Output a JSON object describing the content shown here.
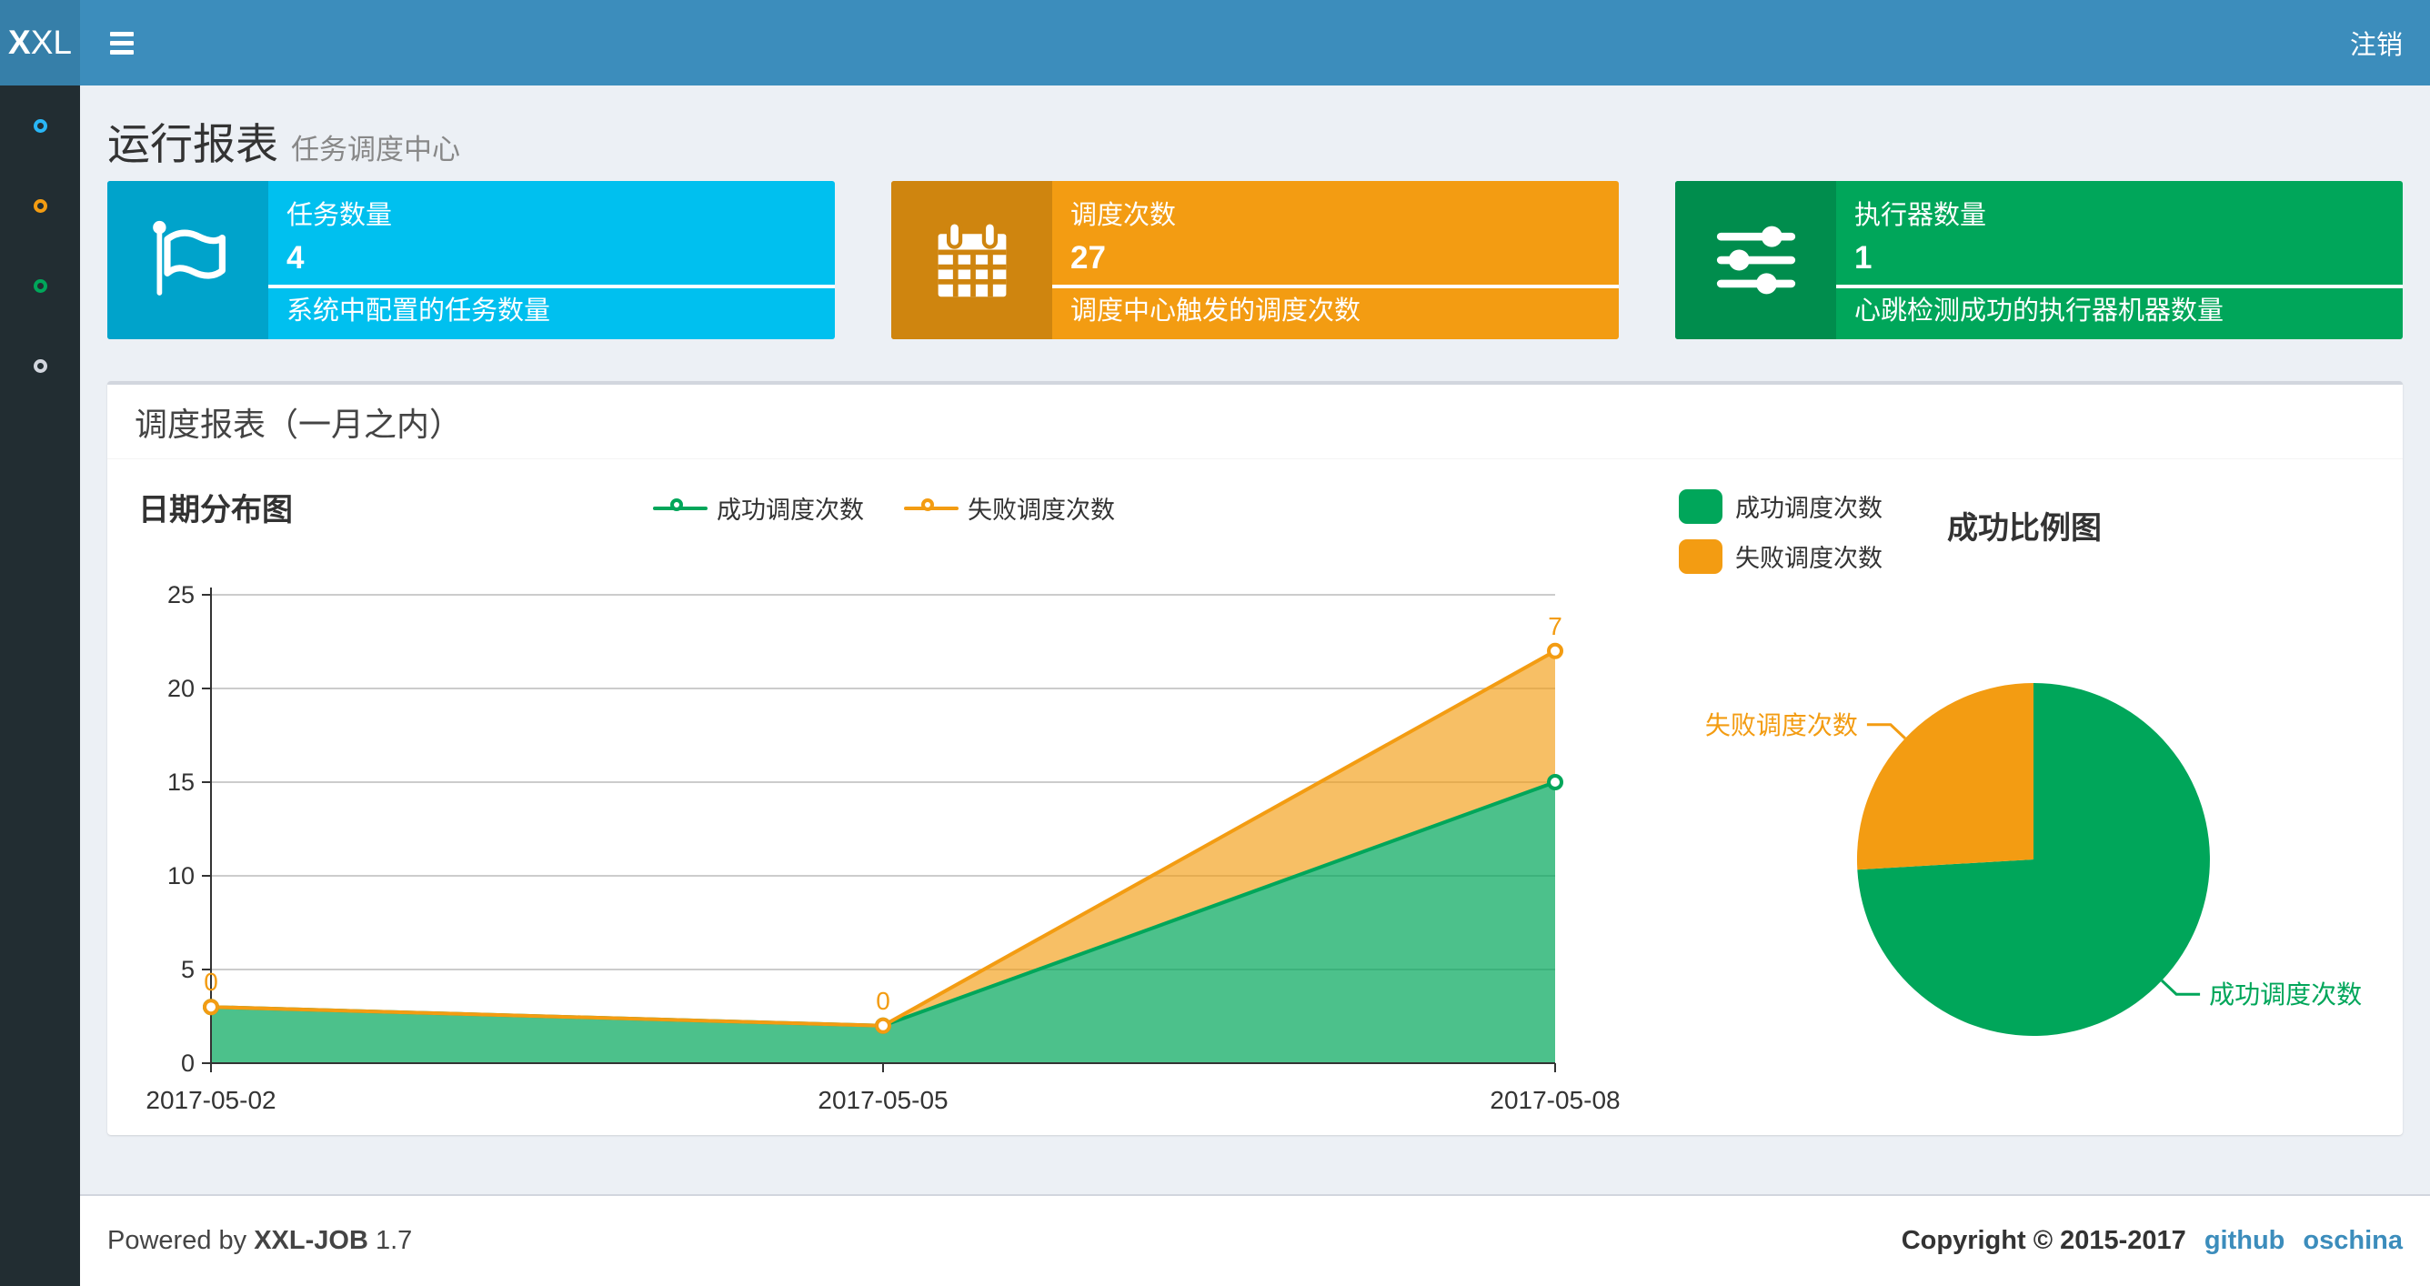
{
  "header": {
    "logo": {
      "bold": "X",
      "rest": "XL"
    },
    "logout_label": "注销"
  },
  "sidebar": {
    "items": [
      {
        "icon": "circle-outline-icon",
        "color": "#29b6f6"
      },
      {
        "icon": "circle-outline-icon",
        "color": "#f39c12"
      },
      {
        "icon": "circle-outline-icon",
        "color": "#00a65a"
      },
      {
        "icon": "circle-outline-icon",
        "color": "#d2d6de"
      }
    ]
  },
  "page_header": {
    "title": "运行报表",
    "subtitle": "任务调度中心"
  },
  "stat_cards": [
    {
      "title": "任务数量",
      "value": "4",
      "description": "系统中配置的任务数量",
      "color": "#00c0ef",
      "icon_bg": "#00a3cb",
      "icon": "flag-icon"
    },
    {
      "title": "调度次数",
      "value": "27",
      "description": "调度中心触发的调度次数",
      "color": "#f39c12",
      "icon_bg": "#cf850f",
      "icon": "calendar-icon"
    },
    {
      "title": "执行器数量",
      "value": "1",
      "description": "心跳检测成功的执行器机器数量",
      "color": "#00a65a",
      "icon_bg": "#008d4d",
      "icon": "sliders-icon"
    }
  ],
  "panel": {
    "title": "调度报表（一月之内）"
  },
  "chart_data": [
    {
      "type": "area",
      "title": "日期分布图",
      "stacked": true,
      "categories": [
        "2017-05-02",
        "2017-05-05",
        "2017-05-08"
      ],
      "series": [
        {
          "name": "成功调度次数",
          "values": [
            3,
            2,
            15
          ],
          "color": "#00a65a",
          "point_labels": false
        },
        {
          "name": "失败调度次数",
          "values": [
            0,
            0,
            7
          ],
          "color": "#f39c12",
          "point_labels": true
        }
      ],
      "ylim": [
        0,
        25
      ],
      "ytick_step": 5,
      "grid": true,
      "legend_position": "top-center",
      "axis_color": "#333333",
      "grid_color": "#cccccc"
    },
    {
      "type": "pie",
      "title": "成功比例图",
      "slices": [
        {
          "name": "成功调度次数",
          "value": 20,
          "color": "#00a65a"
        },
        {
          "name": "失败调度次数",
          "value": 7,
          "color": "#f39c12"
        }
      ],
      "legend_position": "top-left",
      "label_lines": true
    }
  ],
  "footer": {
    "powered_prefix": "Powered by",
    "brand": "XXL-JOB",
    "version": "1.7",
    "copyright": "Copyright © 2015-2017",
    "links": [
      {
        "label": "github"
      },
      {
        "label": "oschina"
      }
    ],
    "link_color": "#3c8dbc"
  },
  "theme": {
    "header_bg": "#3c8dbc",
    "logo_bg": "#367fa9",
    "sidebar_bg": "#222d32",
    "content_bg": "#ecf0f5"
  }
}
